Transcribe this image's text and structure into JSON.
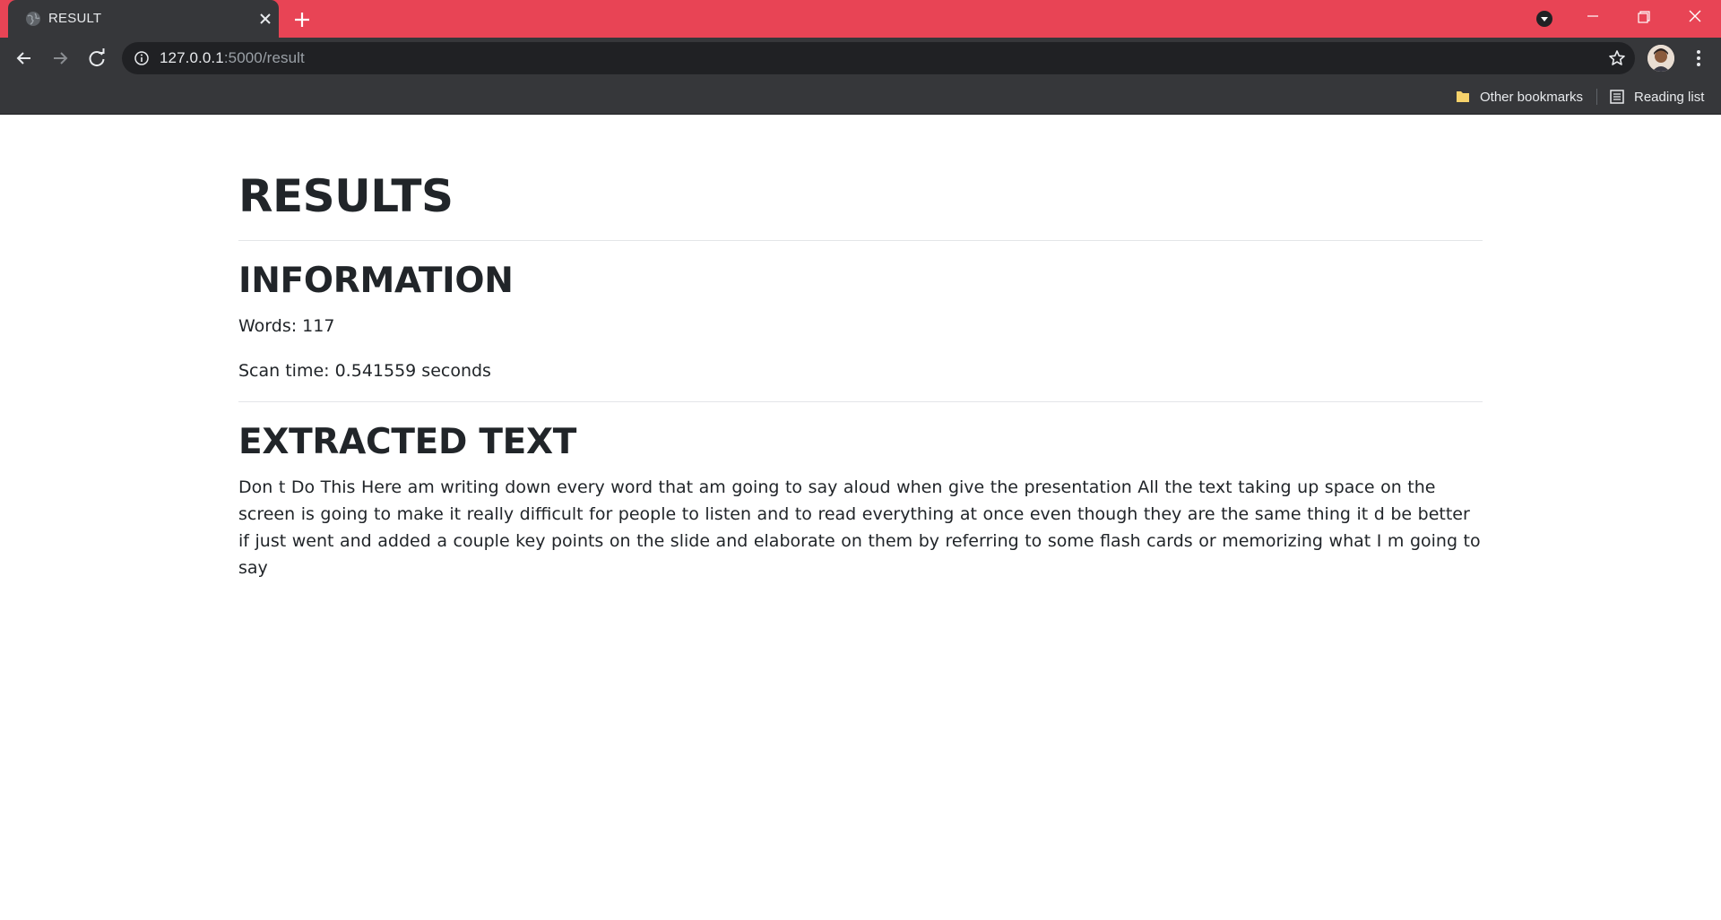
{
  "browser": {
    "tab_title": "RESULT",
    "url_host": "127.0.0.1",
    "url_path": ":5000/result",
    "accent_color": "#e84455",
    "bookmarks": {
      "other_label": "Other bookmarks",
      "reading_label": "Reading list"
    }
  },
  "page": {
    "title": "RESULTS",
    "information": {
      "heading": "INFORMATION",
      "words_line": "Words: 117",
      "scan_time_line": "Scan time: 0.541559 seconds"
    },
    "extracted": {
      "heading": "EXTRACTED TEXT",
      "text": "Don t Do This Here am writing down every word that am going to say aloud when give the presentation All the text taking up space on the screen is going to make it really difficult for people to listen and to read everything at once even though they are the same thing it d be better if just went and added a couple key points on the slide and elaborate on them by referring to some flash cards or memorizing what I m going to say"
    }
  }
}
